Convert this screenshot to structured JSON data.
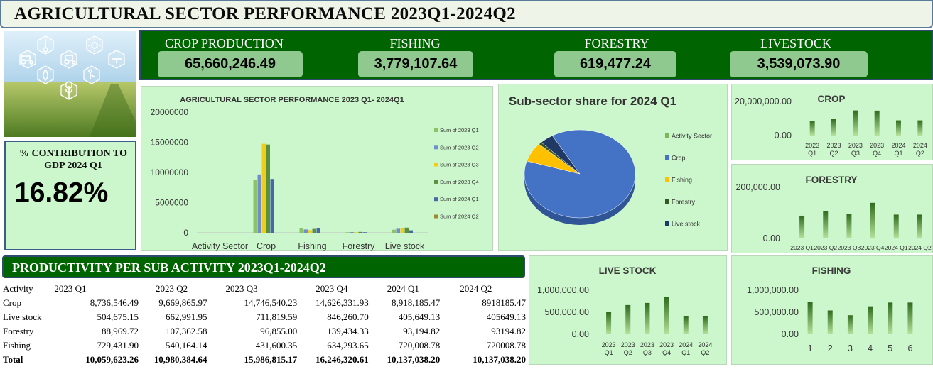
{
  "title": "AGRICULTURAL SECTOR PERFORMANCE 2023Q1-2024Q2",
  "contribution": {
    "label": "% CONTRIBUTION TO GDP 2024 Q1",
    "value": "16.82%"
  },
  "kpis": [
    {
      "label": "CROP PRODUCTION",
      "value": "65,660,246.49"
    },
    {
      "label": "FISHING",
      "value": "3,779,107.64"
    },
    {
      "label": "FORESTRY",
      "value": "619,477.24"
    },
    {
      "label": "LIVESTOCK",
      "value": "3,539,073.90"
    }
  ],
  "colors": {
    "dark_green": "#006400",
    "panel_green": "#ccf7cc",
    "kpi_box": "#8fc98f",
    "series": [
      "#8bc467",
      "#6e8fc9",
      "#f2cc1a",
      "#5a8f3c",
      "#4668a8",
      "#9c8a2c"
    ],
    "pie": [
      "#7ab85a",
      "#4472c4",
      "#ffc000",
      "#375623",
      "#203864"
    ]
  },
  "icons": [
    "tractor-icon",
    "thermometer-icon",
    "tractor-icon",
    "sun-icon",
    "drone-icon",
    "water-drop-icon",
    "farmer-icon",
    "wheat-icon"
  ],
  "productivity": {
    "header": "PRODUCTIVITY PER SUB ACTIVITY 2023Q1-2024Q2",
    "columns": [
      "Activity",
      "2023 Q1",
      "2023 Q2",
      "2023 Q3",
      "2023 Q4",
      "2024 Q1",
      "2024 Q2"
    ],
    "rows": [
      [
        "Crop",
        "8,736,546.49",
        "9,669,865.97",
        "14,746,540.23",
        "14,626,331.93",
        "8,918,185.47",
        "8918185.47"
      ],
      [
        "Live stock",
        "504,675.15",
        "662,991.95",
        "711,819.59",
        "846,260.70",
        "405,649.13",
        "405649.13"
      ],
      [
        "Forestry",
        "88,969.72",
        "107,362.58",
        "96,855.00",
        "139,434.33",
        "93,194.82",
        "93194.82"
      ],
      [
        "Fishing",
        "729,431.90",
        "540,164.14",
        "431,600.35",
        "634,293.65",
        "720,008.78",
        "720008.78"
      ],
      [
        "Total",
        "10,059,623.26",
        "10,980,384.64",
        "15,986,815.17",
        "16,246,320.61",
        "10,137,038.20",
        "10,137,038.20"
      ]
    ]
  },
  "chart_data": [
    {
      "type": "bar",
      "title": "AGRICULTURAL SECTOR PERFORMANCE 2023 Q1- 2024Q1",
      "categories": [
        "Activity Sector",
        "Crop",
        "Fishing",
        "Forestry",
        "Live stock"
      ],
      "yticks": [
        "20000000",
        "15000000",
        "10000000",
        "5000000",
        "0"
      ],
      "ylim": [
        0,
        20000000
      ],
      "legend_position": "right",
      "series": [
        {
          "name": "Sum of 2023 Q1",
          "values": [
            0,
            8736546.49,
            729431.9,
            88969.72,
            504675.15
          ]
        },
        {
          "name": "Sum of 2023 Q2",
          "values": [
            0,
            9669865.97,
            540164.14,
            107362.58,
            662991.95
          ]
        },
        {
          "name": "Sum of 2023 Q3",
          "values": [
            0,
            14746540.23,
            431600.35,
            96855.0,
            711819.59
          ]
        },
        {
          "name": "Sum of 2023 Q4",
          "values": [
            0,
            14626331.93,
            634293.65,
            139434.33,
            846260.7
          ]
        },
        {
          "name": "Sum of 2024 Q1",
          "values": [
            0,
            8918185.47,
            720008.78,
            93194.82,
            405649.13
          ]
        },
        {
          "name": "Sum of 2024 Q2",
          "values": [
            0,
            0,
            0,
            0,
            0
          ]
        }
      ]
    },
    {
      "type": "pie",
      "title": "Sub-sector share for 2024 Q1",
      "legend_position": "right",
      "categories": [
        "Activity Sector",
        "Crop",
        "Fishing",
        "Forestry",
        "Live stock"
      ],
      "values": [
        0,
        8918185.47,
        720008.78,
        93194.82,
        405649.13
      ]
    },
    {
      "type": "bar",
      "title": "CROP",
      "yticks": [
        "20,000,000.00",
        "0.00"
      ],
      "ylim": [
        0,
        20000000
      ],
      "categories": [
        "2023 Q1",
        "2023 Q2",
        "2023 Q3",
        "2023 Q4",
        "2024 Q1",
        "2024 Q2"
      ],
      "values": [
        8736546.49,
        9669865.97,
        14746540.23,
        14626331.93,
        8918185.47,
        8918185.47
      ]
    },
    {
      "type": "bar",
      "title": "FORESTRY",
      "yticks": [
        "200,000.00",
        "0.00"
      ],
      "ylim": [
        0,
        200000
      ],
      "categories": [
        "2023 Q1",
        "2023 Q2",
        "2023 Q3",
        "2023 Q4",
        "2024 Q1",
        "2024 Q2"
      ],
      "values": [
        88969.72,
        107362.58,
        96855.0,
        139434.33,
        93194.82,
        93194.82
      ]
    },
    {
      "type": "bar",
      "title": "LIVE STOCK",
      "yticks": [
        "1,000,000.00",
        "500,000.00",
        "0.00"
      ],
      "ylim": [
        0,
        1000000
      ],
      "categories": [
        "2023 Q1",
        "2023 Q2",
        "2023 Q3",
        "2023 Q4",
        "2024 Q1",
        "2024 Q2"
      ],
      "values": [
        504675.15,
        662991.95,
        711819.59,
        846260.7,
        405649.13,
        405649.13
      ]
    },
    {
      "type": "bar",
      "title": "FISHING",
      "yticks": [
        "1,000,000.00",
        "500,000.00",
        "0.00"
      ],
      "ylim": [
        0,
        1000000
      ],
      "categories": [
        "1",
        "2",
        "3",
        "4",
        "5",
        "6"
      ],
      "values": [
        729431.9,
        540164.14,
        431600.35,
        634293.65,
        720008.78,
        720008.78
      ]
    }
  ]
}
